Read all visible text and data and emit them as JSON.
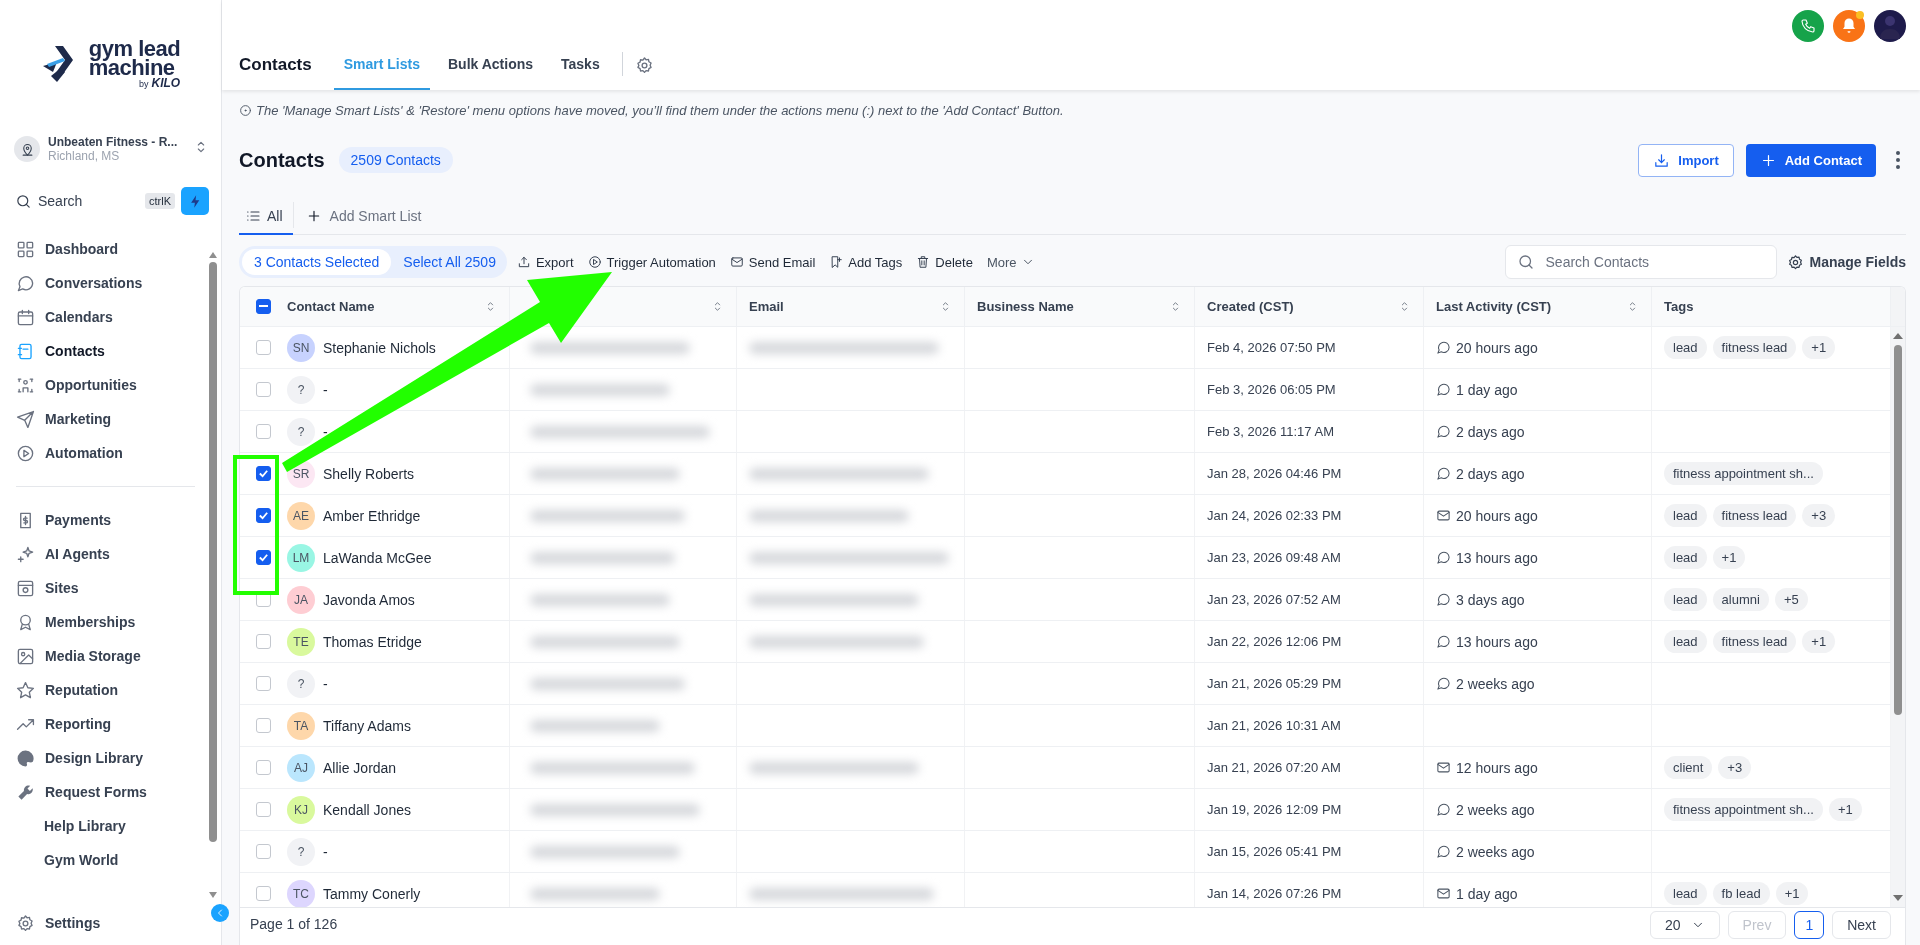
{
  "logo": {
    "line1": "gym lead",
    "line2": "machine",
    "by": "by",
    "brand": "KILO"
  },
  "account": {
    "name": "Unbeaten Fitness - R...",
    "location": "Richland, MS"
  },
  "search": {
    "label": "Search",
    "shortcut": "ctrlK"
  },
  "nav": {
    "primary": [
      {
        "label": "Dashboard",
        "selected": false
      },
      {
        "label": "Conversations",
        "selected": false
      },
      {
        "label": "Calendars",
        "selected": false
      },
      {
        "label": "Contacts",
        "selected": true
      },
      {
        "label": "Opportunities",
        "selected": false
      },
      {
        "label": "Marketing",
        "selected": false
      },
      {
        "label": "Automation",
        "selected": false
      }
    ],
    "secondary": [
      {
        "label": "Payments",
        "selected": false
      },
      {
        "label": "AI Agents",
        "selected": false
      },
      {
        "label": "Sites",
        "selected": false
      },
      {
        "label": "Memberships",
        "selected": false
      },
      {
        "label": "Media Storage",
        "selected": false
      },
      {
        "label": "Reputation",
        "selected": false
      },
      {
        "label": "Reporting",
        "selected": false
      },
      {
        "label": "Design Library",
        "selected": false
      },
      {
        "label": "Request Forms",
        "selected": false
      },
      {
        "label": "Help Library",
        "selected": false
      },
      {
        "label": "Gym World",
        "selected": false
      }
    ]
  },
  "settings": {
    "label": "Settings"
  },
  "header": {
    "title": "Contacts",
    "tabs": [
      {
        "label": "Smart Lists",
        "selected": true
      },
      {
        "label": "Bulk Actions",
        "selected": false
      },
      {
        "label": "Tasks",
        "selected": false
      }
    ]
  },
  "notice": "The 'Manage Smart Lists' & 'Restore' menu options have moved, you’ll find them under the actions menu (:) next to the 'Add Contact' Button.",
  "page": {
    "title": "Contacts",
    "count": "2509 Contacts",
    "import": "Import",
    "add": "Add Contact"
  },
  "smart_lists": [
    {
      "label": "All",
      "selected": true
    }
  ],
  "add_smart_list": "Add Smart List",
  "selection": {
    "selected_label": "3 Contacts Selected",
    "select_all": "Select All 2509"
  },
  "bulk_actions": [
    "Export",
    "Trigger Automation",
    "Send Email",
    "Add Tags",
    "Delete"
  ],
  "more": "More",
  "search_contacts": {
    "placeholder": "Search Contacts"
  },
  "manage_fields": "Manage Fields",
  "table": {
    "select_all_indeterminate": true,
    "columns": [
      {
        "label": "Contact Name",
        "sortable": true
      },
      {
        "sortable": true
      },
      {
        "label": "Email",
        "sortable": true
      },
      {
        "label": "Business Name",
        "sortable": true
      },
      {
        "label": "Created (CST)",
        "sortable": true
      },
      {
        "label": "Last Activity (CST)",
        "sortable": true
      },
      {
        "label": "Tags",
        "sortable": false
      }
    ],
    "rows": [
      {
        "checked": false,
        "initials": "SN",
        "color": "#c7d2fe",
        "name": "Stephanie Nichols",
        "email_blurred": true,
        "created": "Feb 4, 2026 07:50 PM",
        "activity": {
          "kind": "chat",
          "text": "20 hours ago"
        },
        "tags": [
          "lead",
          "fitness lead",
          "+1"
        ]
      },
      {
        "checked": false,
        "initials": "?",
        "color": "#f1f2f5",
        "name": "-",
        "email_blurred": false,
        "created": "Feb 3, 2026 06:05 PM",
        "activity": {
          "kind": "chat",
          "text": "1 day ago"
        },
        "tags": []
      },
      {
        "checked": false,
        "initials": "?",
        "color": "#f1f2f5",
        "name": "-",
        "email_blurred": false,
        "created": "Feb 3, 2026 11:17 AM",
        "activity": {
          "kind": "chat",
          "text": "2 days ago"
        },
        "tags": []
      },
      {
        "checked": true,
        "initials": "SR",
        "color": "#fce7f3",
        "name": "Shelly Roberts",
        "email_blurred": true,
        "created": "Jan 28, 2026 04:46 PM",
        "activity": {
          "kind": "chat",
          "text": "2 days ago"
        },
        "tags": [
          "fitness appointment sh..."
        ]
      },
      {
        "checked": true,
        "initials": "AE",
        "color": "#fed7aa",
        "name": "Amber Ethridge",
        "email_blurred": true,
        "created": "Jan 24, 2026 02:33 PM",
        "activity": {
          "kind": "email",
          "text": "20 hours ago"
        },
        "tags": [
          "lead",
          "fitness lead",
          "+3"
        ]
      },
      {
        "checked": true,
        "initials": "LM",
        "color": "#99f6e4",
        "name": "LaWanda McGee",
        "email_blurred": true,
        "created": "Jan 23, 2026 09:48 AM",
        "activity": {
          "kind": "chat",
          "text": "13 hours ago"
        },
        "tags": [
          "lead",
          "+1"
        ]
      },
      {
        "checked": false,
        "initials": "JA",
        "color": "#fecdd3",
        "name": "Javonda Amos",
        "email_blurred": true,
        "created": "Jan 23, 2026 07:52 AM",
        "activity": {
          "kind": "chat",
          "text": "3 days ago"
        },
        "tags": [
          "lead",
          "alumni",
          "+5"
        ]
      },
      {
        "checked": false,
        "initials": "TE",
        "color": "#d9f99d",
        "name": "Thomas Etridge",
        "email_blurred": true,
        "created": "Jan 22, 2026 12:06 PM",
        "activity": {
          "kind": "chat",
          "text": "13 hours ago"
        },
        "tags": [
          "lead",
          "fitness lead",
          "+1"
        ]
      },
      {
        "checked": false,
        "initials": "?",
        "color": "#f1f2f5",
        "name": "-",
        "email_blurred": false,
        "created": "Jan 21, 2026 05:29 PM",
        "activity": {
          "kind": "chat",
          "text": "2 weeks ago"
        },
        "tags": []
      },
      {
        "checked": false,
        "initials": "TA",
        "color": "#fed7aa",
        "name": "Tiffany Adams",
        "email_blurred": false,
        "created": "Jan 21, 2026 10:31 AM",
        "tags": []
      },
      {
        "checked": false,
        "initials": "AJ",
        "color": "#bae6fd",
        "name": "Allie Jordan",
        "email_blurred": true,
        "created": "Jan 21, 2026 07:20 AM",
        "activity": {
          "kind": "email",
          "text": "12 hours ago"
        },
        "tags": [
          "client",
          "+3"
        ]
      },
      {
        "checked": false,
        "initials": "KJ",
        "color": "#d9f99d",
        "name": "Kendall Jones",
        "email_blurred": false,
        "created": "Jan 19, 2026 12:09 PM",
        "activity": {
          "kind": "chat",
          "text": "2 weeks ago"
        },
        "tags": [
          "fitness appointment sh...",
          "+1"
        ]
      },
      {
        "checked": false,
        "initials": "?",
        "color": "#f1f2f5",
        "name": "-",
        "email_blurred": false,
        "created": "Jan 15, 2026 05:41 PM",
        "activity": {
          "kind": "chat",
          "text": "2 weeks ago"
        },
        "tags": []
      },
      {
        "checked": false,
        "initials": "TC",
        "color": "#ddd6fe",
        "name": "Tammy Conerly",
        "email_blurred": true,
        "created": "Jan 14, 2026 07:26 PM",
        "activity": {
          "kind": "email",
          "text": "1 day ago"
        },
        "tags": [
          "lead",
          "fb lead",
          "+1"
        ]
      }
    ]
  },
  "pagination": {
    "summary": "Page 1 of 126",
    "page_size": "20",
    "prev": {
      "label": "Prev",
      "disabled": true
    },
    "pages": [
      {
        "label": "1",
        "selected": true
      }
    ],
    "next": {
      "label": "Next",
      "disabled": false
    }
  }
}
